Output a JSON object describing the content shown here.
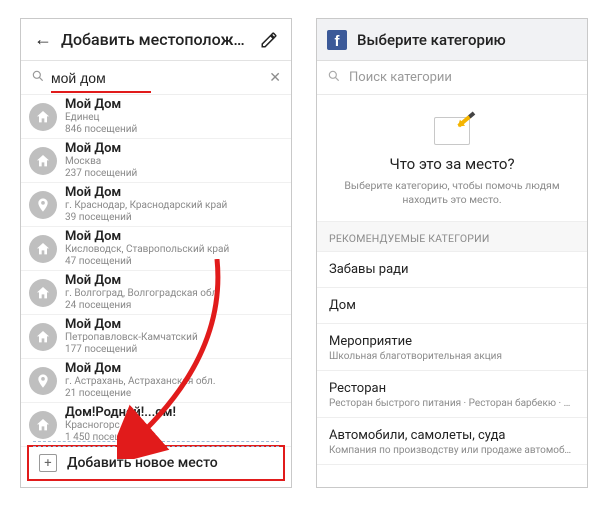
{
  "left": {
    "header_title": "Добавить местоположен…",
    "search_value": "мой дом",
    "results": [
      {
        "icon": "home",
        "title": "Мой Дом",
        "sub": "Единец",
        "visits": "846 посещений"
      },
      {
        "icon": "home",
        "title": "Мой Дом",
        "sub": "Москва",
        "visits": "237 посещений"
      },
      {
        "icon": "pin",
        "title": "Мой Дом",
        "sub": "г. Краснодар, Краснодарский край",
        "visits": "39 посещений"
      },
      {
        "icon": "home",
        "title": "Мой Дом",
        "sub": "Кисловодск, Ставропольский край",
        "visits": "47 посещений"
      },
      {
        "icon": "home",
        "title": "Мой Дом",
        "sub": "г. Волгоград, Волгоградская обл.",
        "visits": "24 посещения"
      },
      {
        "icon": "home",
        "title": "Мой Дом",
        "sub": "Петропавловск-Камчатский",
        "visits": "177 посещений"
      },
      {
        "icon": "pin",
        "title": "Мой Дом",
        "sub": "г. Астрахань, Астраханская обл.",
        "visits": "21 посещение"
      },
      {
        "icon": "home",
        "title": "Дом!Родной!...ом!",
        "sub": "Красногорс",
        "visits": "1 450 посещений"
      }
    ],
    "add_label": "Добавить новое место"
  },
  "right": {
    "header_title": "Выберите категорию",
    "search_placeholder": "Поиск категории",
    "promo_title": "Что это за место?",
    "promo_sub": "Выберите категорию, чтобы помочь людям находить это место.",
    "section_label": "РЕКОМЕНДУЕМЫЕ КАТЕГОРИИ",
    "cats": [
      {
        "name": "Забавы ради",
        "sub": ""
      },
      {
        "name": "Дом",
        "sub": ""
      },
      {
        "name": "Мероприятие",
        "sub": "Школьная благотворительная акция"
      },
      {
        "name": "Ресторан",
        "sub": "Ресторан быстрого питания · Ресторан барбекю · Рест…"
      },
      {
        "name": "Автомобили, самолеты, суда",
        "sub": "Компания по производству или продаже автомобилей"
      }
    ]
  }
}
